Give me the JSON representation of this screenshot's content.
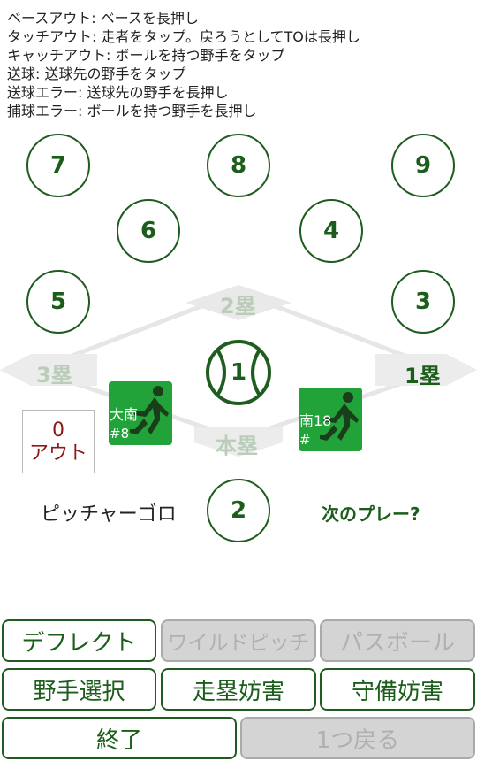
{
  "instructions": [
    "ベースアウト: ベースを長押し",
    "タッチアウト: 走者をタップ。戻ろうとしてTOは長押し",
    "キャッチアウト: ボールを持つ野手をタップ",
    "送球: 送球先の野手をタップ",
    "送球エラー: 送球先の野手を長押し",
    "捕球エラー: ボールを持つ野手を長押し"
  ],
  "positions": {
    "p1": "1",
    "p2": "2",
    "p3": "3",
    "p4": "4",
    "p5": "5",
    "p6": "6",
    "p7": "7",
    "p8": "8",
    "p9": "9"
  },
  "bases": {
    "first": "1塁",
    "second": "2塁",
    "third": "3塁",
    "home": "本塁"
  },
  "runners": {
    "left": {
      "name": "大南",
      "number": "#8"
    },
    "right": {
      "name": "南18",
      "number": "#"
    }
  },
  "outs": {
    "count": "0",
    "label": "アウト"
  },
  "status": {
    "play": "ピッチャーゴロ",
    "next": "次のプレー?"
  },
  "buttons": {
    "deflect": "デフレクト",
    "wild_pitch": "ワイルドピッチ",
    "passed_ball": "パスボール",
    "fielder_choice": "野手選択",
    "runner_interference": "走塁妨害",
    "defense_obstruction": "守備妨害",
    "finish": "終了",
    "undo": "1つ戻る"
  },
  "colors": {
    "accent": "#1b5e1b",
    "runner": "#22a33a",
    "out": "#8b1a1a",
    "disabled": "#d4d4d4"
  }
}
